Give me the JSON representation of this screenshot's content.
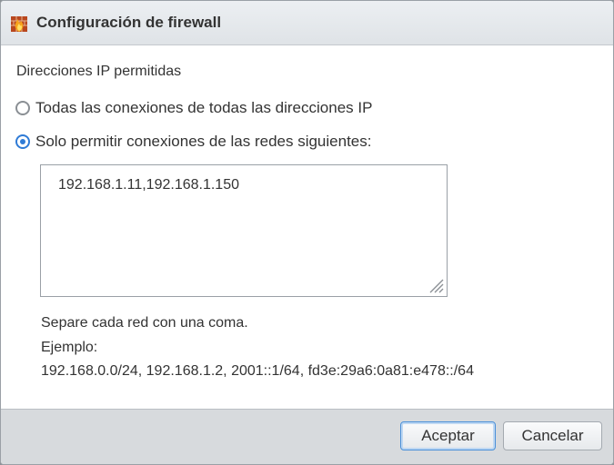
{
  "dialog": {
    "title": "Configuración de firewall",
    "title_icon": "firewall-icon",
    "section_label": "Direcciones IP permitidas",
    "options": [
      {
        "label": "Todas las conexiones de todas las direcciones IP",
        "checked": false
      },
      {
        "label": "Solo permitir conexiones de las redes siguientes:",
        "checked": true
      }
    ],
    "allowed_ips_value": "192.168.1.11,192.168.1.150",
    "help": {
      "line1": "Separe cada red con una coma.",
      "line2": "Ejemplo:",
      "line3": "192.168.0.0/24, 192.168.1.2, 2001::1/64, fd3e:29a6:0a81:e478::/64"
    },
    "buttons": {
      "accept": "Aceptar",
      "cancel": "Cancelar"
    },
    "colors": {
      "accent": "#2f7bd6",
      "footer_bg": "#d7dadd",
      "titlebar_bg": "#e4e7ea"
    }
  }
}
